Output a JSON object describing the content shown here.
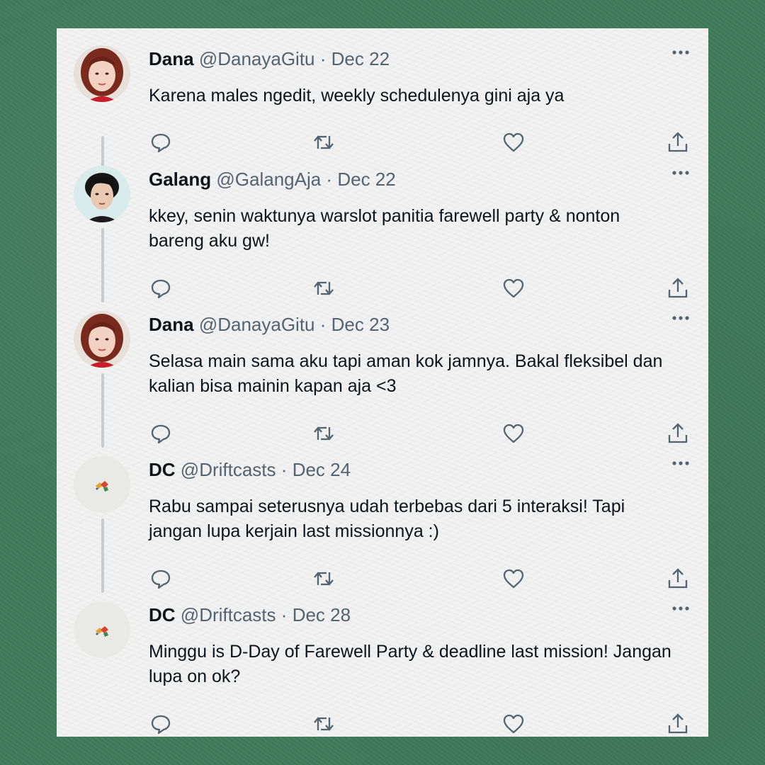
{
  "tweets": [
    {
      "name": "Dana",
      "handle": "@DanayaGitu",
      "dot": "·",
      "date": "Dec 22",
      "text": "Karena males ngedit, weekly schedulenya gini aja ya",
      "avatar": "avatar-woman"
    },
    {
      "name": "Galang",
      "handle": "@GalangAja",
      "dot": "·",
      "date": "Dec 22",
      "text": "kkey, senin waktunya warslot panitia farewell party & nonton bareng aku gw!",
      "avatar": "avatar-man"
    },
    {
      "name": "Dana",
      "handle": "@DanayaGitu",
      "dot": "·",
      "date": "Dec 23",
      "text": "Selasa main sama aku tapi aman kok jamnya. Bakal fleksibel dan kalian bisa mainin kapan aja <3",
      "avatar": "avatar-woman"
    },
    {
      "name": "DC",
      "handle": "@Driftcasts",
      "dot": "·",
      "date": "Dec 24",
      "text": "Rabu sampai seterusnya udah terbebas dari 5 interaksi! Tapi jangan lupa kerjain last missionnya :)",
      "avatar": "avatar-logo"
    },
    {
      "name": "DC",
      "handle": "@Driftcasts",
      "dot": "·",
      "date": "Dec 28",
      "text": "Minggu is D-Day of Farewell Party & deadline last mission! Jangan lupa on ok?",
      "avatar": "avatar-logo"
    }
  ],
  "icons": {
    "more": "more-icon",
    "reply": "reply-icon",
    "retweet": "retweet-icon",
    "like": "like-icon",
    "share": "share-icon"
  },
  "colors": {
    "background": "#3f7b5a",
    "card": "#f1f2f1",
    "text": "#0f1419",
    "secondary": "#536471",
    "thread_line": "#c7ccd1"
  }
}
